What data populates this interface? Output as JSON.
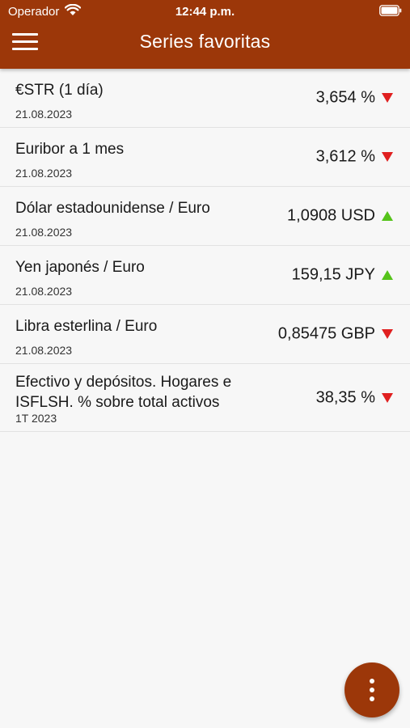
{
  "status_bar": {
    "carrier": "Operador",
    "time": "12:44 p.m."
  },
  "header": {
    "title": "Series favoritas",
    "menu_icon": "hamburger-menu-icon"
  },
  "colors": {
    "brand": "#9c3709",
    "trend_down": "#e02020",
    "trend_up": "#55c31a"
  },
  "series": [
    {
      "name": "€STR (1 día)",
      "date": "21.08.2023",
      "value": "3,654 %",
      "trend": "down"
    },
    {
      "name": "Euribor a 1 mes",
      "date": "21.08.2023",
      "value": "3,612 %",
      "trend": "down"
    },
    {
      "name": "Dólar estadounidense / Euro",
      "date": "21.08.2023",
      "value": "1,0908 USD",
      "trend": "up"
    },
    {
      "name": "Yen japonés / Euro",
      "date": "21.08.2023",
      "value": "159,15 JPY",
      "trend": "up"
    },
    {
      "name": "Libra esterlina / Euro",
      "date": "21.08.2023",
      "value": "0,85475 GBP",
      "trend": "down"
    },
    {
      "name": "Efectivo y depósitos. Hogares e ISFLSH. % sobre total activos",
      "date": "1T 2023",
      "value": "38,35 %",
      "trend": "down"
    }
  ],
  "fab": {
    "icon": "more-vertical-icon"
  }
}
